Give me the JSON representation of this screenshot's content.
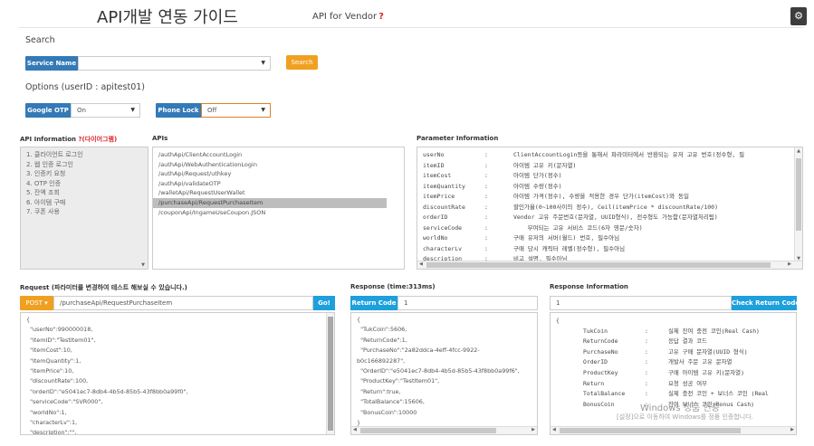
{
  "header": {
    "title": "API개발 연동 가이드",
    "subtitle": "API for Vendor",
    "help_mark": "?",
    "settings_icon": "gear-icon"
  },
  "search": {
    "section_label": "Search",
    "service_name_label": "Service Name",
    "service_name_value": "",
    "search_button": "Search"
  },
  "options": {
    "section_label": "Options (userID : apitest01)",
    "google_otp_label": "Google OTP",
    "google_otp_value": "On",
    "phone_lock_label": "Phone Lock",
    "phone_lock_value": "Off"
  },
  "api_information": {
    "header": "API Information",
    "header_link": "?(다이어그램)",
    "items": [
      "1. 클라이언트 로그인",
      "2. 웹 인증 로그인",
      "3. 인증키 요청",
      "4. OTP 인증",
      "5. 잔액 조회",
      "6. 아이템 구매",
      "7. 쿠폰 사용"
    ]
  },
  "apis": {
    "header": "APIs",
    "items": [
      "/authApi/ClientAccountLogin",
      "/authApi/WebAuthenticationLogin",
      "/authApi/Request/uthkey",
      "/authApi/validateOTP",
      "/walletApi/RequestUserWallet",
      "/purchaseApi/RequestPurchaseItem",
      "/couponApi/IngameUseCoupon.JSON"
    ],
    "selected_index": 5
  },
  "parameter_information": {
    "header": "Parameter Information",
    "rows": [
      {
        "name": "userNo",
        "sep": ":",
        "desc": "ClientAccountLogin등을 통해서 파라미터에서 반환되는 유저 고유 번호(정수형, 필"
      },
      {
        "name": "itemID",
        "sep": ":",
        "desc": "아이템 고유 키(문자열)"
      },
      {
        "name": "itemCost",
        "sep": ":",
        "desc": "아이템 단가(정수)"
      },
      {
        "name": "itemQuantity",
        "sep": ":",
        "desc": "아이템 수량(정수)"
      },
      {
        "name": "itemPrice",
        "sep": ":",
        "desc": "아이템 가격(정수), 수량을 적용한 경우 단가(itemCost)와 동일"
      },
      {
        "name": "discountRate",
        "sep": ":",
        "desc": "할인가율(0~100사이의 정수), Ceil(itemPrice * discountRate/100)"
      },
      {
        "name": "orderID",
        "sep": ":",
        "desc": "Vendor 고유 주문번호(문자열, UUID형식), 전수형도 가능함(문자열처리됨)"
      },
      {
        "name": "serviceCode",
        "sep": ":",
        "desc": "    부여되는 고유 서비스 코드(6자 영문/숫자)"
      },
      {
        "name": "worldNo",
        "sep": ":",
        "desc": "구매 유저의 서버(월드) 번호, 필수아님"
      },
      {
        "name": "characterLv",
        "sep": ":",
        "desc": "구매 당시 캐릭터 레벨(정수형), 필수아님"
      },
      {
        "name": "description",
        "sep": ":",
        "desc": "비고 설명, 필수아님"
      }
    ]
  },
  "request": {
    "header": "Request (파라미터를 변경하여 테스트 해보실 수 있습니다.)",
    "method": "POST",
    "url": "/purchaseApi/RequestPurchaseItem",
    "go_button": "Go!",
    "body_lines": [
      "{",
      "  \"userNo\":990000018,",
      "  \"itemID\":\"TestItem01\",",
      "  \"itemCost\":10,",
      "  \"itemQuantity\":1,",
      "  \"itemPrice\":10,",
      "  \"discountRate\":100,",
      "  \"orderID\":\"e5041ec7-8db4-4b5d-85b5-43f8bb0a99f0\",",
      "  \"serviceCode\":\"SVR000\",",
      "  \"worldNo\":1,",
      "  \"characterLv\":1,",
      "  \"description\":\"\","
    ]
  },
  "response": {
    "header": "Response (time:313ms)",
    "return_code_label": "Return Code",
    "return_code_value": "1",
    "body_lines": [
      "{",
      "  \"TukCoin\":5606,",
      "  \"ReturnCode\":1,",
      "  \"PurchaseNo\":\"2a82ddca-4eff-4fcc-9922-",
      "b0c166892287\",",
      "  \"OrderID\":\"e5041ec7-8db4-4b5d-85b5-43f8bb0a99f6\",",
      "  \"ProductKey\":\"TestItem01\",",
      "  \"Return\":true,",
      "  \"TotalBalance\":15606,",
      "  \"BonusCoin\":10000",
      "}"
    ]
  },
  "response_information": {
    "header": "Response Information",
    "input_value": "1",
    "check_button": "Check Return Code",
    "rows": [
      {
        "name": "TukCoin",
        "sep": ":",
        "desc": "실제 잔여 충전 코인(Real Cash)"
      },
      {
        "name": "ReturnCode",
        "sep": ":",
        "desc": "응답 결과 코드"
      },
      {
        "name": "PurchaseNo",
        "sep": ":",
        "desc": "고유 구매 문자열(UUID 형식)"
      },
      {
        "name": "OrderID",
        "sep": ":",
        "desc": "개발사 주문 고유 문자열"
      },
      {
        "name": "ProductKey",
        "sep": ":",
        "desc": "구매 아이템 고유 키(문자열)"
      },
      {
        "name": "Return",
        "sep": ":",
        "desc": "요청 성공 여부"
      },
      {
        "name": "TotalBalance",
        "sep": ":",
        "desc": "실제 충전 코인 + 보너스 코인 (Real"
      },
      {
        "name": "BonusCoin",
        "sep": ":",
        "desc": "잔여 보너스 코인(Bonus Cash)"
      }
    ]
  },
  "watermark": {
    "line1": "Windows 정품 인증",
    "line2": "[설정]으로 이동하여 Windows를 정품 인증합니다."
  }
}
